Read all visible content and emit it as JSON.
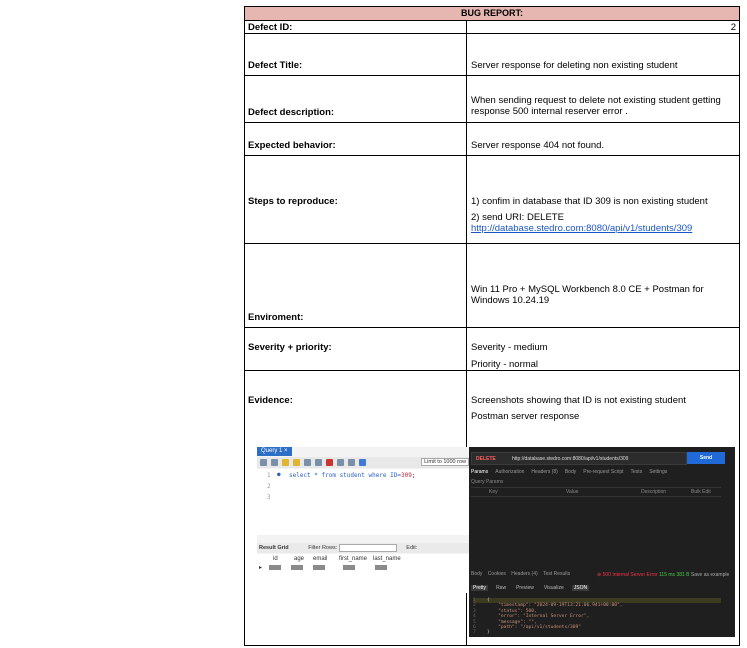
{
  "header": "BUG REPORT:",
  "rows": {
    "defect_id": {
      "label": "Defect ID:",
      "value": "2"
    },
    "title": {
      "label": "Defect Title:",
      "value": "Server response for deleting non existing student"
    },
    "description": {
      "label": "Defect description:",
      "value": "When sending request to delete  not existing student getting response 500 internal reserver error ."
    },
    "expected": {
      "label": "Expected behavior:",
      "value": "Server response 404 not found."
    },
    "steps": {
      "label": "Steps to reproduce:",
      "step1": "1) confim in database that ID 309 is non existing student",
      "step2": "2) send  URI: DELETE",
      "link": "http://database.stedro.com:8080/api/v1/students/309"
    },
    "environment": {
      "label": "Enviroment:",
      "value": "Win 11 Pro + MySQL Workbench 8.0 CE + Postman for Windows 10.24.19"
    },
    "severity": {
      "label": "Severity + priority:",
      "severity": "Severity - medium",
      "priority": "Priority - normal"
    },
    "evidence": {
      "label": "Evidence:",
      "line1": "Screenshots showing that ID is not existing student",
      "line2": "Postman server response"
    }
  },
  "sql": {
    "tab": "Query 1",
    "limit": "Limit to 1000 row",
    "line1_pre": "select * from student where ID=",
    "line1_num": "309",
    "line_numbers": [
      "1",
      "2",
      "3"
    ],
    "result_grid": "Result Grid",
    "filter_label": "Filter Rows:",
    "edit_label": "Edit:",
    "columns": [
      "id",
      "age",
      "email",
      "first_name",
      "last_name"
    ],
    "null_label": "NULL"
  },
  "postman": {
    "method": "DELETE",
    "url": "http://database.stedro.com:8080/api/v1/students/309",
    "send": "Send",
    "tabs": [
      "Params",
      "Authorization",
      "Headers (8)",
      "Body",
      "Pre-request Script",
      "Tests",
      "Settings"
    ],
    "query_params": "Query Params",
    "cols": [
      "Key",
      "Value",
      "Description"
    ],
    "bulk": "Bulk Edit",
    "res_tabs": [
      "Body",
      "Cookies",
      "Headers (4)",
      "Test Results"
    ],
    "status": "500 Internal Server Error",
    "time": "115 ms",
    "size": "381 B",
    "save": "Save as example",
    "view_tabs": [
      "Pretty",
      "Raw",
      "Preview",
      "Visualize",
      "JSON"
    ],
    "json_lines": [
      {
        "n": "1",
        "t": "{"
      },
      {
        "n": "2",
        "t": "    \"timestamp\": \"2024-09-19T13:21:06.941+00:00\","
      },
      {
        "n": "3",
        "t": "    \"status\": 500,"
      },
      {
        "n": "4",
        "t": "    \"error\": \"Internal Server Error\","
      },
      {
        "n": "5",
        "t": "    \"message\": \"\","
      },
      {
        "n": "6",
        "t": "    \"path\": \"/api/v1/students/309\""
      },
      {
        "n": "7",
        "t": "}"
      }
    ]
  }
}
